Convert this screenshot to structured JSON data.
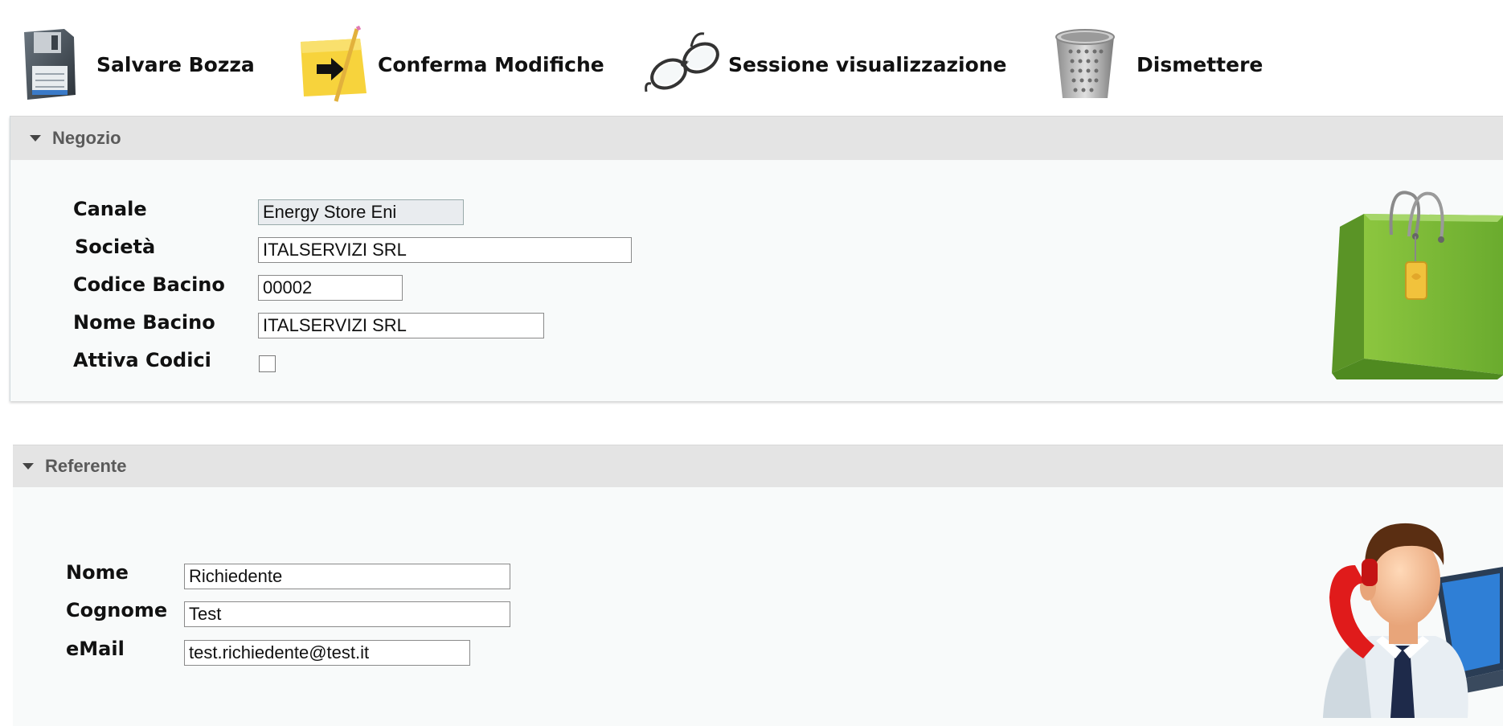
{
  "toolbar": {
    "save_draft": "Salvare Bozza",
    "confirm_changes": "Conferma Modifiche",
    "view_session": "Sessione visualizzazione",
    "decommission": "Dismettere"
  },
  "store_panel": {
    "title": "Negozio",
    "fields": {
      "canale": {
        "label": "Canale",
        "value": "Energy Store Eni"
      },
      "societa": {
        "label": "Società",
        "value": "ITALSERVIZI SRL"
      },
      "codice_bacino": {
        "label": "Codice Bacino",
        "value": "00002"
      },
      "nome_bacino": {
        "label": "Nome Bacino",
        "value": "ITALSERVIZI SRL"
      },
      "attiva_codici": {
        "label": "Attiva Codici",
        "checked": false
      }
    },
    "icon": "shopping-bag-icon"
  },
  "contact_panel": {
    "title": "Referente",
    "fields": {
      "nome": {
        "label": "Nome",
        "value": "Richiedente"
      },
      "cognome": {
        "label": "Cognome",
        "value": "Test"
      },
      "email": {
        "label": "eMail",
        "value": "test.richiedente@test.it"
      }
    },
    "icon": "contact-person-icon"
  },
  "colors": {
    "panel_header": "#e4e4e4",
    "panel_body": "#f8fafa",
    "bag_green": "#7dbb3a"
  }
}
